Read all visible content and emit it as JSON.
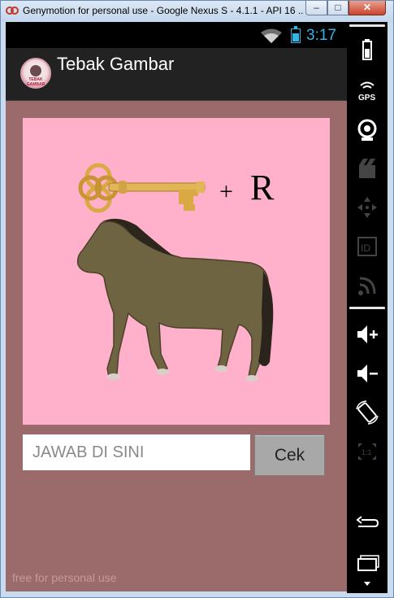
{
  "window": {
    "title": "Genymotion for personal use - Google Nexus S - 4.1.1 - API 16 ...",
    "minimize_symbol": "–",
    "maximize_symbol": "□",
    "close_symbol": "✕"
  },
  "statusbar": {
    "time": "3:17",
    "accent_color": "#33b5e5"
  },
  "actionbar": {
    "title": "Tebak Gambar",
    "logo_text": "TEBAK GAMBAR"
  },
  "puzzle": {
    "plus_symbol": "+",
    "letter": "R",
    "background_color": "#ffb0cb"
  },
  "answer": {
    "placeholder": "JAWAB DI SINI",
    "value": ""
  },
  "check_button": {
    "label": "Cek"
  },
  "watermark": {
    "text": "free for personal use"
  },
  "side_panel": {
    "gps_label": "GPS",
    "id_label": "ID",
    "scale_label": "1:1",
    "icons": [
      "battery-icon",
      "gps-icon",
      "camera-icon",
      "video-icon",
      "dpad-icon",
      "identity-icon",
      "rss-icon",
      "volume-up-icon",
      "volume-down-icon",
      "rotate-icon",
      "scale-icon",
      "back-icon",
      "recent-apps-icon",
      "menu-down-icon"
    ]
  },
  "colors": {
    "screen_background": "#9b6a6b",
    "actionbar_background": "#222222"
  }
}
